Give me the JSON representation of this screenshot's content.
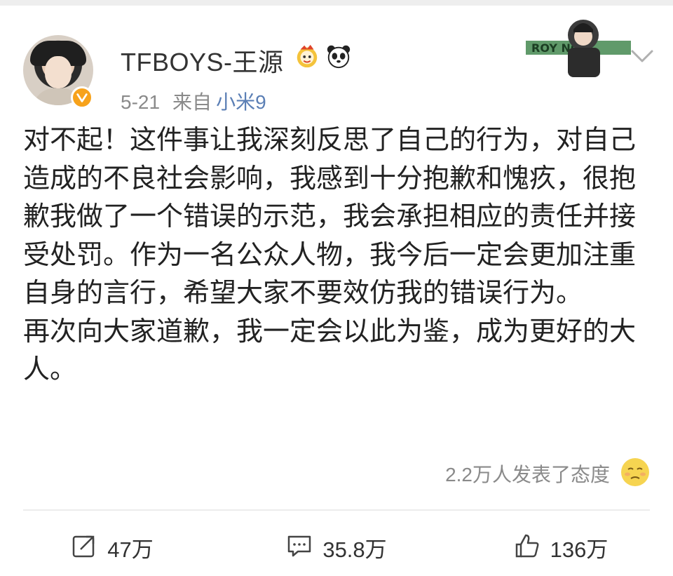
{
  "post": {
    "username": "TFBOYS-王源",
    "date": "5-21",
    "source_label": "来自",
    "source": "小米9",
    "badges": [
      "weibo-lion-badge-icon",
      "panda-badge-icon"
    ],
    "card_deco_text": "ROY NG",
    "content": [
      "对不起！这件事让我深刻反思了自己的行为，对自己造成的不良社会影响，我感到十分抱歉和愧疚，很抱歉我做了一个错误的示范，我会承担相应的责任并接受处罚。作为一名公众人物，我今后一定会更加注重自身的言行，希望大家不要效仿我的错误行为。",
      "再次向大家道歉，我一定会以此为鉴，成为更好的大人。"
    ],
    "attitude_text": "2.2万人发表了态度"
  },
  "actions": {
    "repost": {
      "icon": "repost-icon",
      "count": "47万"
    },
    "comment": {
      "icon": "comment-icon",
      "count": "35.8万"
    },
    "like": {
      "icon": "thumbs-up-icon",
      "count": "136万"
    }
  },
  "colors": {
    "verified": "#f7a21b",
    "source_link": "#5b7fb5",
    "muted_text": "#8a8a8a"
  }
}
